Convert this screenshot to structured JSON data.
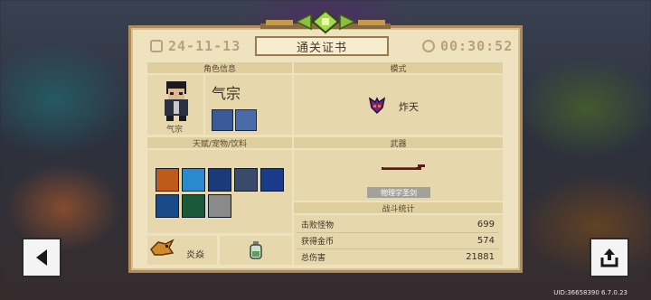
{
  "certificate": {
    "title": "通关证书",
    "date": "24-11-13",
    "time": "00:30:52"
  },
  "character": {
    "section_label": "角色信息",
    "name": "气宗",
    "name_small": "气宗"
  },
  "mode": {
    "section_label": "模式",
    "name": "炸天"
  },
  "talents": {
    "section_label": "天赋/宠物/饮料",
    "pet_name": "炎焱"
  },
  "weapon": {
    "section_label": "武器",
    "name": "物理学圣剑"
  },
  "battle_stats": {
    "section_label": "战斗统计",
    "rows": [
      {
        "label": "击败怪物",
        "value": "699"
      },
      {
        "label": "获得金币",
        "value": "574"
      },
      {
        "label": "总伤害",
        "value": "21881"
      }
    ]
  },
  "footer": {
    "uid": "UID:36658390 6.7.0.23"
  },
  "icons": {
    "back": "back-arrow-icon",
    "share": "share-icon"
  },
  "colors": {
    "panel": "#efe2be",
    "section_header": "#dfcf9f",
    "accent_gold": "#b08a5a"
  }
}
